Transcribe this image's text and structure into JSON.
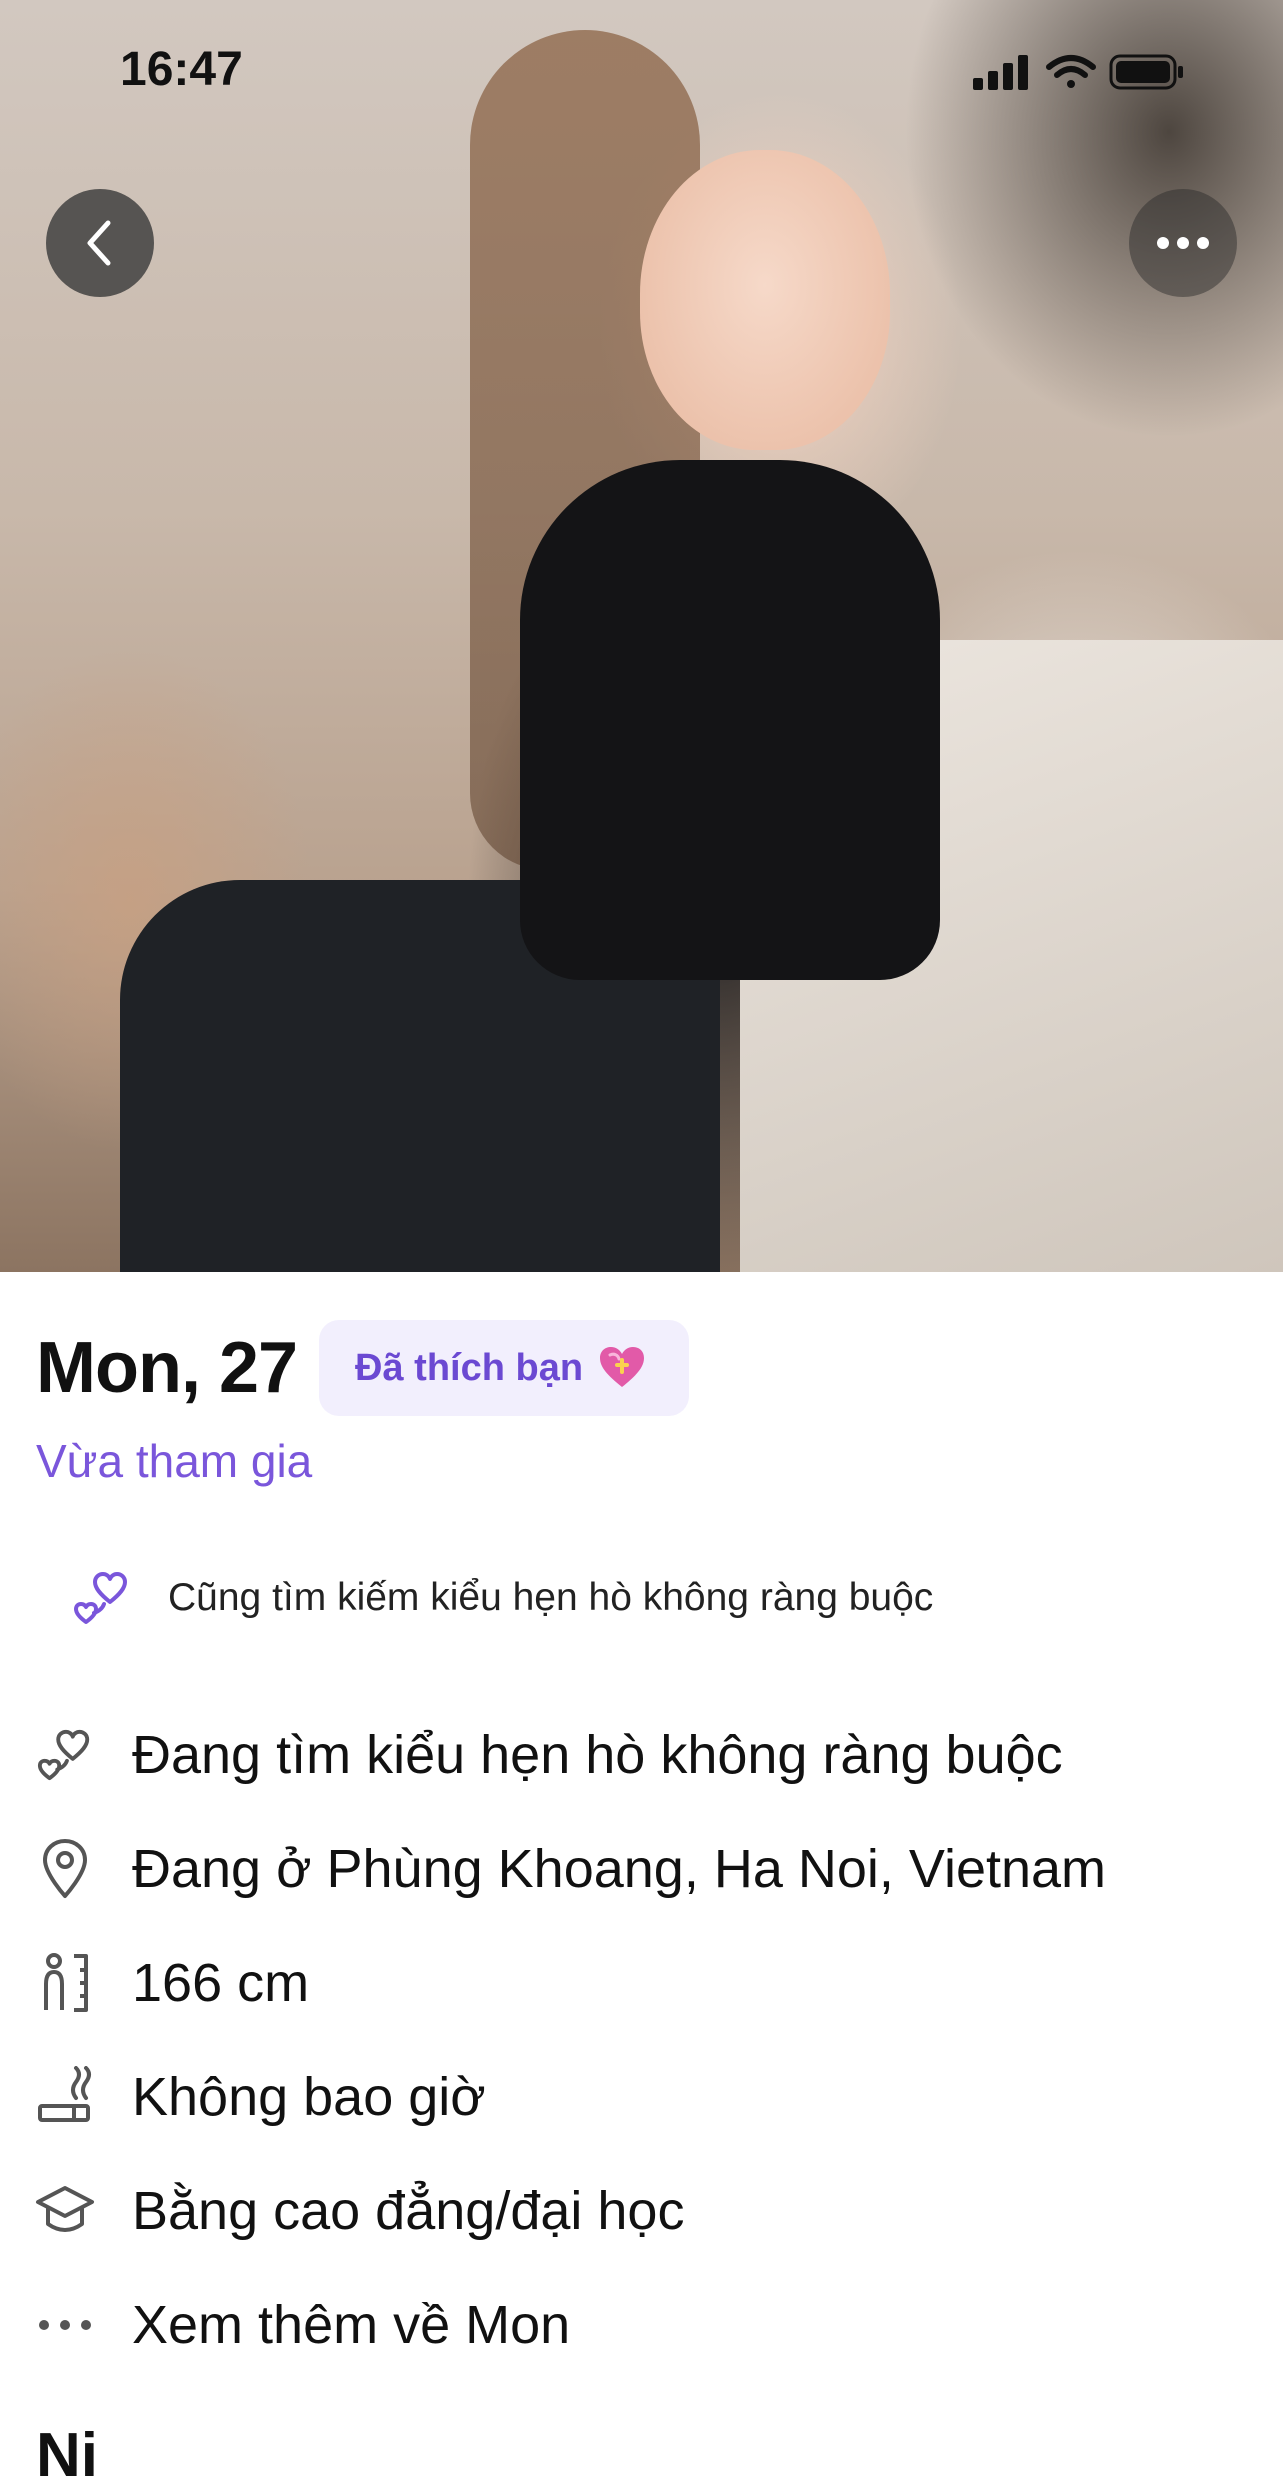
{
  "status_bar": {
    "time": "16:47"
  },
  "nav": {
    "back_icon": "chevron-left-icon",
    "more_icon": "ellipsis-icon"
  },
  "profile": {
    "name_age": "Mon, 27",
    "liked_badge": "Đã thích bạn",
    "liked_emoji_icon": "heart-with-ribbon-icon",
    "joined": "Vừa tham gia",
    "shared_intent": "Cũng tìm kiếm kiểu hẹn hò không ràng buộc"
  },
  "details": [
    {
      "icon": "hearts-icon",
      "text": "Đang tìm kiểu hẹn hò không ràng buộc"
    },
    {
      "icon": "location-pin-icon",
      "text": "Đang ở Phùng Khoang, Ha Noi, Vietnam"
    },
    {
      "icon": "height-icon",
      "text": "166 cm"
    },
    {
      "icon": "cigarette-icon",
      "text": "Không bao giờ"
    },
    {
      "icon": "graduation-cap-icon",
      "text": "Bằng cao đẳng/đại học"
    },
    {
      "icon": "more-dots-icon",
      "text": "Xem thêm về Mon"
    }
  ],
  "next_section_header": "Ni",
  "colors": {
    "accent": "#7a56db",
    "badge_bg": "#f2effd",
    "badge_text": "#6b49d2"
  }
}
